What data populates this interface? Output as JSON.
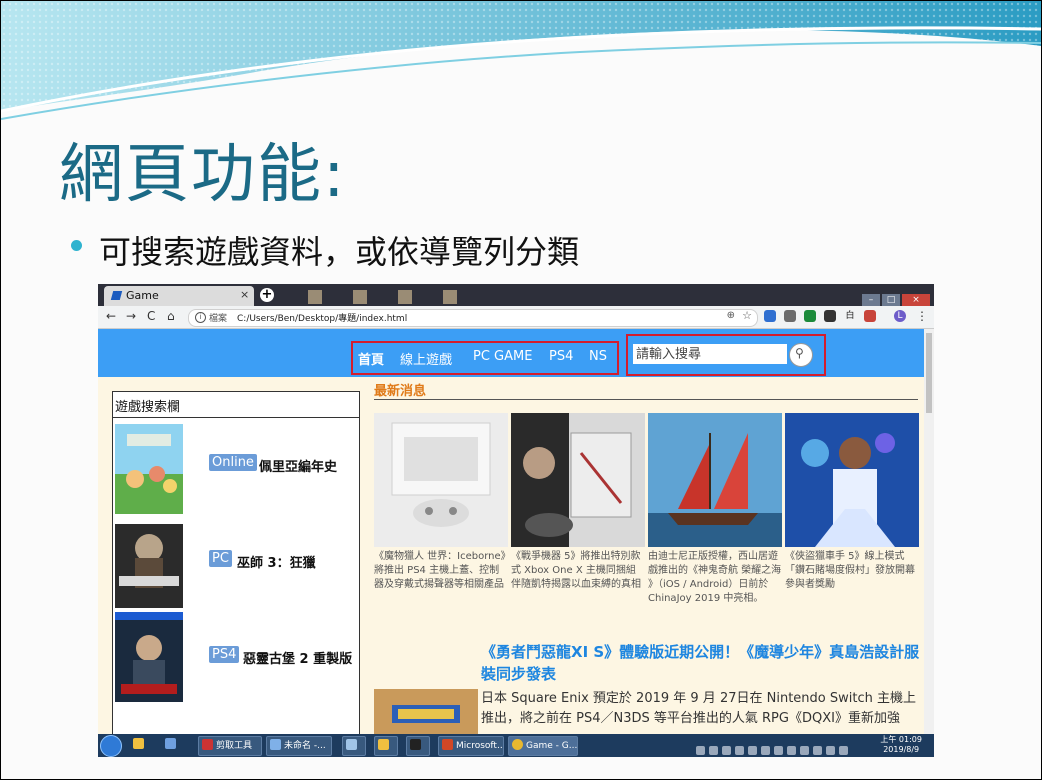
{
  "slide": {
    "title": "網頁功能:",
    "bullet": "可搜索遊戲資料，或依導覽列分類"
  },
  "browser": {
    "tab_title": "Game",
    "tab_close": "×",
    "new_tab": "+",
    "nav_back": "←",
    "nav_forward": "→",
    "nav_reload": "C",
    "nav_home": "⌂",
    "url_label": "檔案",
    "url": "C:/Users/Ben/Desktop/專題/index.html",
    "zoom_icon": "⊕",
    "star_icon": "☆",
    "profile_initial": "L",
    "menu": "⋮",
    "ext_text": "白"
  },
  "site": {
    "nav": [
      "首頁",
      "線上遊戲",
      "PC GAME",
      "PS4",
      "NS"
    ],
    "search_placeholder": "請輸入搜尋",
    "sidebar_title": "遊戲搜索欄",
    "games": [
      {
        "tag": "Online",
        "name": "佩里亞編年史"
      },
      {
        "tag": "PC",
        "name": "巫師 3：狂獵"
      },
      {
        "tag": "PS4",
        "name": "惡靈古堡 2 重製版"
      }
    ],
    "news_header": "最新消息",
    "news_cards": [
      {
        "caption": "《魔物獵人 世界：Iceborne》將推出 PS4 主機上蓋、控制器及穿戴式揚聲器等相關產品"
      },
      {
        "caption": "《戰爭機器 5》將推出特別款式 Xbox One X 主機同捆組 伴隨凱特揭露以血束縛的真相"
      },
      {
        "caption": "由迪士尼正版授權，西山居遊戲推出的《神鬼奇航 榮耀之海 》（iOS / Android）日前於 ChinaJoy 2019 中亮相。"
      },
      {
        "caption": "《俠盜獵車手 5》線上模式「鑽石賭場度假村」發放開幕參與者獎勵"
      }
    ],
    "headline": "《勇者鬥惡龍XI S》體驗版近期公開！《魔導少年》真島浩設計服裝同步發表",
    "body": "日本 Square Enix 預定於 2019 年 9 月 27日在 Nintendo Switch 主機上推出，將之前在 PS4／N3DS 等平台推出的人氣 RPG《DQXI》重新加強"
  },
  "taskbar": {
    "items": [
      "剪取工具",
      "未命名 -...",
      "",
      "",
      "",
      "Microsoft...",
      "Game - G..."
    ],
    "time": "上午 01:09",
    "date": "2019/8/9"
  },
  "colors": {
    "title": "#1b6a86",
    "accent": "#2fb3cf",
    "header_blue": "#3c9ef5",
    "highlight_red": "#d41d2c",
    "news_orange": "#e07b1a",
    "headline_blue": "#1e86e0"
  }
}
